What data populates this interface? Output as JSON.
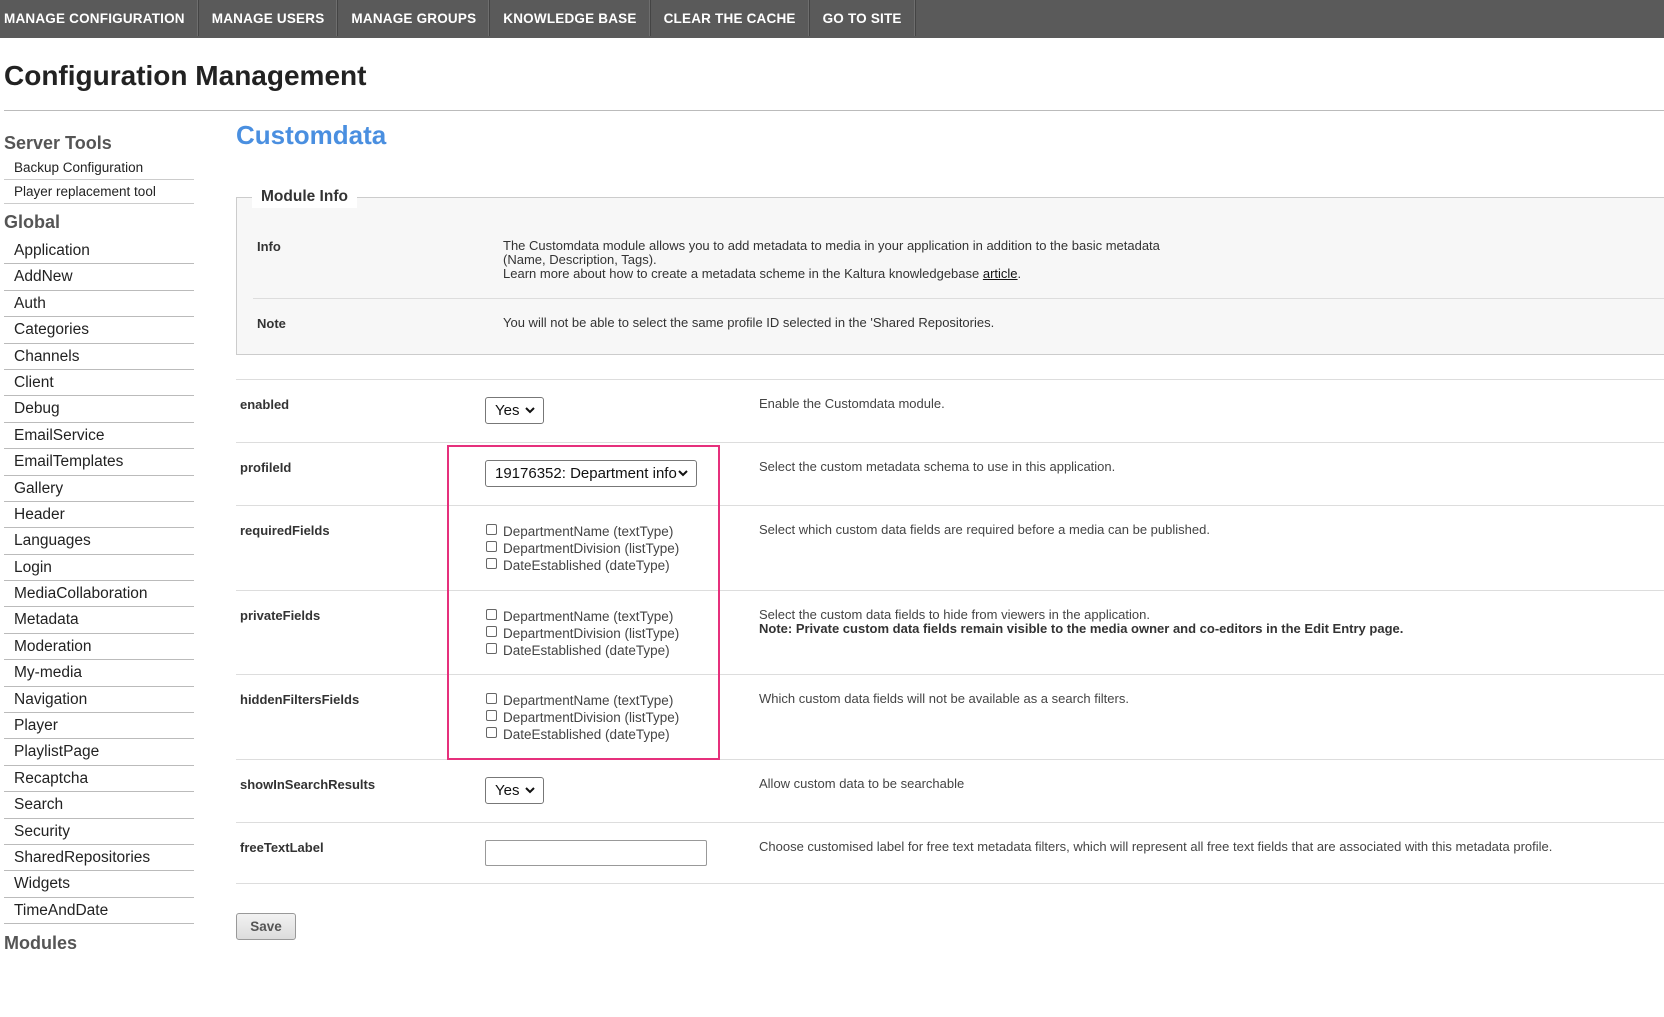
{
  "topnav": [
    "MANAGE CONFIGURATION",
    "MANAGE USERS",
    "MANAGE GROUPS",
    "KNOWLEDGE BASE",
    "CLEAR THE CACHE",
    "GO TO SITE"
  ],
  "page_title": "Configuration Management",
  "sidebar": {
    "server_tools_heading": "Server Tools",
    "server_tools": [
      "Backup Configuration",
      "Player replacement tool"
    ],
    "global_heading": "Global",
    "global_items": [
      "Application",
      "AddNew",
      "Auth",
      "Categories",
      "Channels",
      "Client",
      "Debug",
      "EmailService",
      "EmailTemplates",
      "Gallery",
      "Header",
      "Languages",
      "Login",
      "MediaCollaboration",
      "Metadata",
      "Moderation",
      "My-media",
      "Navigation",
      "Player",
      "PlaylistPage",
      "Recaptcha",
      "Search",
      "Security",
      "SharedRepositories",
      "Widgets",
      "TimeAndDate"
    ],
    "modules_heading": "Modules"
  },
  "main": {
    "section_title": "Customdata",
    "module_info": {
      "legend": "Module Info",
      "info_label": "Info",
      "info_line1": "The Customdata module allows you to add metadata to media in your application in addition to the basic metadata",
      "info_line2": "(Name, Description, Tags).",
      "info_line3_prefix": "Learn more about how to create a metadata scheme in the Kaltura knowledgebase ",
      "info_link": "article",
      "info_line3_suffix": ".",
      "note_label": "Note",
      "note_text": "You will not be able to select the same profile ID selected in the 'Shared Repositories."
    },
    "fields": {
      "enabled": {
        "label": "enabled",
        "value": "Yes",
        "desc": "Enable the Customdata module."
      },
      "profileId": {
        "label": "profileId",
        "value": "19176352: Department info",
        "desc": "Select the custom metadata schema to use in this application."
      },
      "requiredFields": {
        "label": "requiredFields",
        "desc": "Select which custom data fields are required before a media can be published."
      },
      "privateFields": {
        "label": "privateFields",
        "desc": "Select the custom data fields to hide from viewers in the application.",
        "note": "Note: Private custom data fields remain visible to the media owner and co-editors in the Edit Entry page."
      },
      "hiddenFiltersFields": {
        "label": "hiddenFiltersFields",
        "desc": "Which custom data fields will not be available as a search filters."
      },
      "showInSearchResults": {
        "label": "showInSearchResults",
        "value": "Yes",
        "desc": "Allow custom data to be searchable"
      },
      "freeTextLabel": {
        "label": "freeTextLabel",
        "value": "",
        "desc": "Choose customised label for free text metadata filters, which will represent all free text fields that are associated with this metadata profile."
      }
    },
    "checkbox_options": [
      "DepartmentName (textType)",
      "DepartmentDivision (listType)",
      "DateEstablished (dateType)"
    ],
    "save_label": "Save"
  }
}
